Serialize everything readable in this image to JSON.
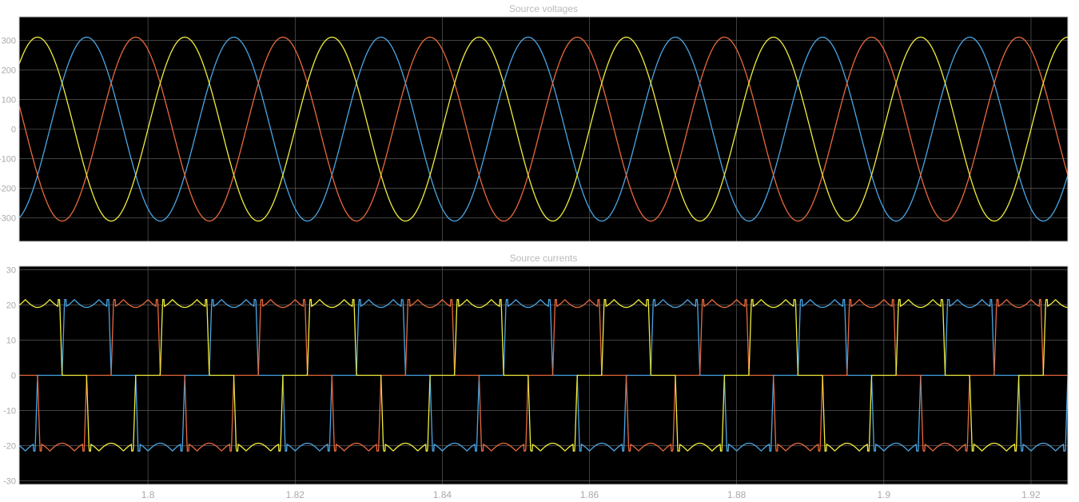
{
  "chart_data": [
    {
      "type": "line",
      "title": "Source voltages",
      "xlabel": "",
      "ylabel": "",
      "xlim": [
        1.7825,
        1.925
      ],
      "ylim": [
        -380,
        380
      ],
      "yticks": [
        -300,
        -200,
        -100,
        0,
        100,
        200,
        300
      ],
      "ytick_labels": [
        "-300",
        "-200",
        "-100",
        "0",
        "100",
        "200",
        "300"
      ],
      "xticks": [
        1.8,
        1.82,
        1.84,
        1.86,
        1.88,
        1.9,
        1.92
      ],
      "xtick_labels": [
        "1.8",
        "1.82",
        "1.84",
        "1.86",
        "1.88",
        "1.9",
        "1.92"
      ],
      "grid": true,
      "waveform": {
        "shape": "sinusoid",
        "frequency_hz": 50,
        "amplitude": 311
      },
      "series": [
        {
          "color": "#4aa6e6",
          "phase_deg": -120,
          "x": [
            1.7825,
            1.7875,
            1.7925,
            1.7975,
            1.8025
          ],
          "y": [
            -302.0,
            0.0,
            311.0,
            0.0,
            -311.0
          ]
        },
        {
          "color": "#e8693c",
          "phase_deg": 120,
          "x": [
            1.7825,
            1.7875,
            1.7925,
            1.7975,
            1.8025
          ],
          "y": [
            109.0,
            -272.0,
            -109.0,
            272.0,
            109.0
          ]
        },
        {
          "color": "#f1ee3c",
          "phase_deg": 0,
          "x": [
            1.7825,
            1.7875,
            1.7925,
            1.7975,
            1.8025
          ],
          "y": [
            194.0,
            243.0,
            -194.0,
            -243.0,
            194.0
          ]
        }
      ]
    },
    {
      "type": "line",
      "title": "Source currents",
      "xlabel": "",
      "ylabel": "",
      "xlim": [
        1.7825,
        1.925
      ],
      "ylim": [
        -31,
        31
      ],
      "yticks": [
        -30,
        -20,
        -10,
        0,
        10,
        20,
        30
      ],
      "ytick_labels": [
        "-30",
        "-20",
        "-10",
        "0",
        "10",
        "20",
        "30"
      ],
      "xticks": [
        1.8,
        1.82,
        1.84,
        1.86,
        1.88,
        1.9,
        1.92
      ],
      "xtick_labels": [
        "1.8",
        "1.82",
        "1.84",
        "1.86",
        "1.88",
        "1.9",
        "1.92"
      ],
      "grid": true,
      "waveform": {
        "shape": "six-pulse rectifier line current",
        "frequency_hz": 50,
        "amplitude": 21.5
      },
      "series": [
        {
          "color": "#4aa6e6",
          "phase_deg": -120,
          "x": [
            1.785,
            1.7875,
            1.79,
            1.7925,
            1.7975,
            1.8025
          ],
          "y": [
            -21.5,
            0.0,
            21.5,
            21.5,
            0.0,
            -21.5
          ]
        },
        {
          "color": "#e8693c",
          "phase_deg": 120,
          "x": [
            1.7825,
            1.7845,
            1.7875,
            1.7925,
            1.7975
          ],
          "y": [
            21.5,
            0.0,
            -21.5,
            -21.5,
            21.5
          ]
        },
        {
          "color": "#f1ee3c",
          "phase_deg": 0,
          "x": [
            1.7825,
            1.7845,
            1.7875,
            1.7925,
            1.8025
          ],
          "y": [
            0.0,
            21.5,
            21.5,
            -21.5,
            0.0
          ]
        }
      ]
    }
  ]
}
